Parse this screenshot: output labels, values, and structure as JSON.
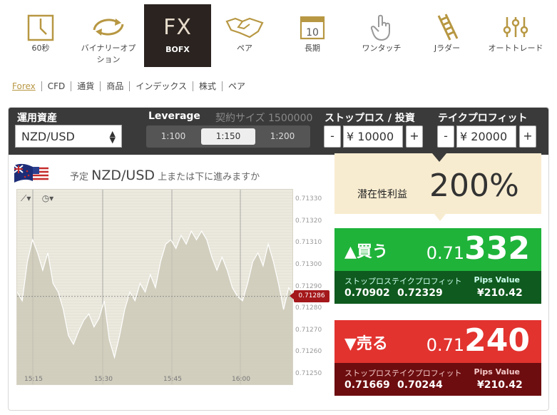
{
  "toolbar": {
    "items": [
      {
        "label": "60秒",
        "icon": "clock-icon"
      },
      {
        "label": "バイナリーオプション",
        "icon": "cycle-arrows-icon"
      },
      {
        "label": "BOFX",
        "icon": "fx-icon",
        "glyph": "FX",
        "active": true
      },
      {
        "label": "ペア",
        "icon": "handshake-icon"
      },
      {
        "label": "長期",
        "icon": "calendar-icon",
        "glyph": "10"
      },
      {
        "label": "ワンタッチ",
        "icon": "touch-icon"
      },
      {
        "label": "Jラダー",
        "icon": "ladder-icon"
      },
      {
        "label": "オートトレード",
        "icon": "sliders-icon"
      }
    ]
  },
  "categories": [
    "Forex",
    "CFD",
    "通貨",
    "商品",
    "インデックス",
    "株式",
    "ペア"
  ],
  "controls": {
    "asset_label": "運用資産",
    "asset_value": "NZD/USD",
    "leverage_label": "Leverage",
    "contract_label": "契約サイズ 1500000",
    "leverage_options": [
      "1:100",
      "1:150",
      "1:200"
    ],
    "leverage_selected": "1:150",
    "stoploss_label": "ストップロス / 投資",
    "stoploss_value": "¥ 10000",
    "takeprofit_label": "テイクプロフィット",
    "takeprofit_value": "¥ 20000",
    "minus": "-",
    "plus": "+"
  },
  "headline": {
    "prefix": "予定",
    "pair": "NZD/USD",
    "suffix": "上または下に進みますか"
  },
  "chart_data": {
    "type": "area",
    "x_ticks": [
      "15:15",
      "15:30",
      "15:45",
      "16:00"
    ],
    "y_ticks": [
      "0.71330",
      "0.71320",
      "0.71310",
      "0.71300",
      "0.71290",
      "0.71280",
      "0.71270",
      "0.71260",
      "0.71250"
    ],
    "ylim": [
      0.71245,
      0.71335
    ],
    "current_value": "0.71286",
    "current": 0.71286,
    "values": [
      0.71288,
      0.71284,
      0.71302,
      0.71312,
      0.71306,
      0.71298,
      0.71306,
      0.71292,
      0.71288,
      0.7128,
      0.71268,
      0.71264,
      0.7127,
      0.71275,
      0.71278,
      0.71272,
      0.71276,
      0.71284,
      0.71266,
      0.71258,
      0.71268,
      0.7128,
      0.71288,
      0.71284,
      0.71292,
      0.71288,
      0.71296,
      0.7129,
      0.71302,
      0.7131,
      0.71312,
      0.71308,
      0.71314,
      0.7131,
      0.71316,
      0.71312,
      0.71316,
      0.71312,
      0.71304,
      0.71298,
      0.71304,
      0.71298,
      0.7129,
      0.71286,
      0.71284,
      0.71292,
      0.71302,
      0.71306,
      0.713,
      0.7131,
      0.71302,
      0.71292,
      0.7128,
      0.7129,
      0.71286
    ]
  },
  "profit": {
    "label": "潜在性利益",
    "value": "200%"
  },
  "buy": {
    "label": "買う",
    "price_prefix": "0.71",
    "price_main": "332",
    "header": "ストップロステイクプロフィット",
    "pips_label": "Pips Value",
    "stop": "0.70902",
    "take": "0.72329",
    "pips": "¥210.42"
  },
  "sell": {
    "label": "売る",
    "price_prefix": "0.71",
    "price_main": "240",
    "header": "ストップロステイクプロフィット",
    "pips_label": "Pips Value",
    "stop": "0.71669",
    "take": "0.70244",
    "pips": "¥210.42"
  },
  "colors": {
    "accent": "#b79742",
    "buy": "#1fb33a",
    "sell": "#e2332f",
    "dark": "#3a3a3a"
  }
}
